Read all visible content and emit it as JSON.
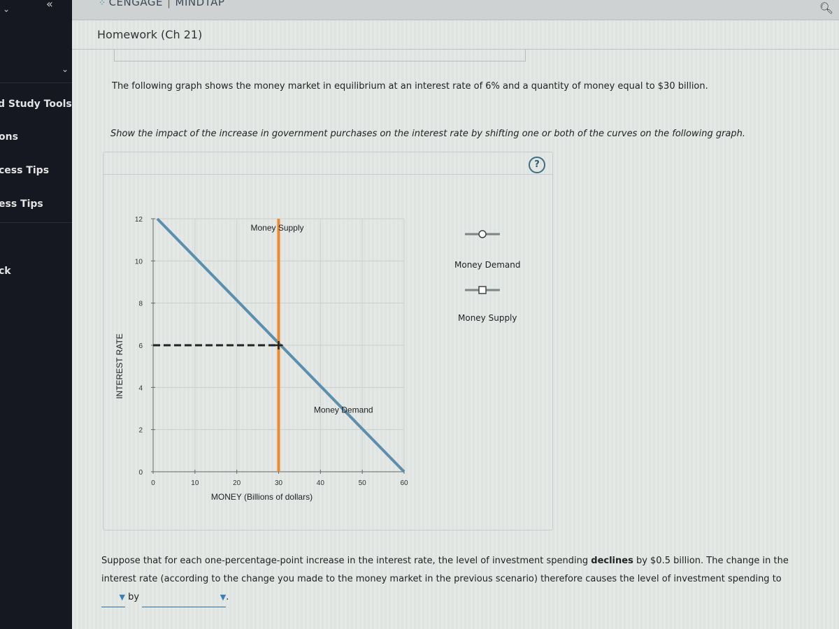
{
  "sidebar": {
    "collapse_icon": "«",
    "items": [
      {
        "label": "d Study Tools"
      },
      {
        "label": "ons"
      },
      {
        "label": "cess Tips"
      },
      {
        "label": "ess Tips"
      },
      {
        "label": "ck"
      }
    ]
  },
  "header": {
    "brand": "CENGAGE",
    "product": "MINDTAP",
    "assignment_title": "Homework (Ch 21)"
  },
  "question": {
    "intro": "The following graph shows the money market in equilibrium at an interest rate of 6% and a quantity of money equal to $30 billion.",
    "instruction": "Show the impact of the increase in government purchases on the interest rate by shifting one or both of the curves on the following graph.",
    "help_label": "?",
    "followup_before_bold": "Suppose that for each one-percentage-point increase in the interest rate, the level of investment spending ",
    "followup_bold": "declines",
    "followup_after_bold": " by $0.5 billion. The change in the interest rate (according to the change you made to the money market in the previous scenario) therefore causes the level of investment spending to",
    "dropdown1_value": "",
    "by_label": "by",
    "dropdown2_value": "",
    "period": "."
  },
  "legend": {
    "items": [
      {
        "label": "Money Demand",
        "marker": "circle"
      },
      {
        "label": "Money Supply",
        "marker": "square"
      }
    ]
  },
  "chart_data": {
    "type": "line",
    "xlabel": "MONEY (Billions of dollars)",
    "ylabel": "INTEREST RATE",
    "xlim": [
      0,
      60
    ],
    "ylim": [
      0,
      12
    ],
    "x_ticks": [
      0,
      10,
      20,
      30,
      40,
      50,
      60
    ],
    "y_ticks": [
      0,
      2,
      4,
      6,
      8,
      10,
      12
    ],
    "grid": true,
    "series": [
      {
        "name": "Money Demand",
        "color": "#5b8fae",
        "points": [
          [
            1,
            12
          ],
          [
            60,
            0
          ]
        ],
        "label": "Money Demand"
      },
      {
        "name": "Money Supply",
        "color": "#ee8a2c",
        "points": [
          [
            30,
            0
          ],
          [
            30,
            12
          ]
        ],
        "label": "Money Supply"
      }
    ],
    "equilibrium": {
      "x": 30,
      "y": 6
    }
  }
}
